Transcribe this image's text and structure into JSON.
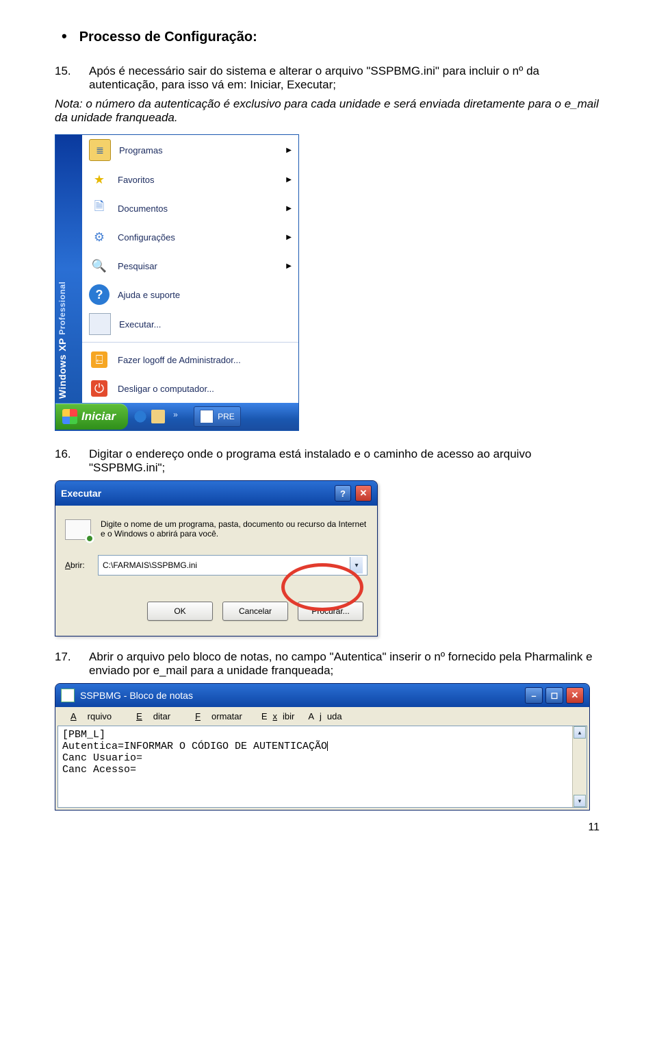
{
  "heading": "Processo de Configuração:",
  "step15": {
    "num": "15.",
    "text": "Após é necessário sair do sistema e alterar o arquivo \"SSPBMG.ini\" para incluir o nº da autenticação, para isso vá em: Iniciar, Executar;"
  },
  "note": "Nota: o número da autenticação é exclusivo para cada unidade e será enviada diretamente para o e_mail da unidade franqueada.",
  "start_menu": {
    "brand_xp": "Windows XP",
    "brand_pro": "Professional",
    "items": [
      {
        "icon": "prog",
        "label": "Programas",
        "arrow": true
      },
      {
        "icon": "fav",
        "label": "Favoritos",
        "arrow": true
      },
      {
        "icon": "doc",
        "label": "Documentos",
        "arrow": true
      },
      {
        "icon": "conf",
        "label": "Configurações",
        "arrow": true
      },
      {
        "icon": "search",
        "label": "Pesquisar",
        "arrow": true
      },
      {
        "icon": "help",
        "label": "Ajuda e suporte",
        "arrow": false
      },
      {
        "icon": "run",
        "label": "Executar...",
        "arrow": false
      }
    ],
    "logoff": "Fazer logoff de Administrador...",
    "shutdown": "Desligar o computador...",
    "start_button": "Iniciar",
    "task_label": "PRE"
  },
  "step16": {
    "num": "16.",
    "text": "Digitar o endereço onde o programa está instalado e o caminho de acesso ao arquivo \"SSPBMG.ini\";"
  },
  "exec": {
    "title": "Executar",
    "desc": "Digite o nome de um programa, pasta, documento ou recurso da Internet e o Windows o abrirá para você.",
    "open_underline": "A",
    "open_rest": "brir:",
    "value": "C:\\FARMAIS\\SSPBMG.ini",
    "ok": "OK",
    "cancel": "Cancelar",
    "browse_underline": "P",
    "browse_rest": "rocurar..."
  },
  "step17": {
    "num": "17.",
    "text": "Abrir o arquivo pelo bloco de notas, no campo \"Autentica\" inserir o nº fornecido pela Pharmalink e enviado por e_mail para a unidade franqueada;"
  },
  "notepad": {
    "title": "SSPBMG - Bloco de notas",
    "menu": [
      {
        "u": "A",
        "rest": "rquivo"
      },
      {
        "u": "E",
        "rest": "ditar"
      },
      {
        "u": "F",
        "rest": "ormatar"
      },
      {
        "u": "",
        "rest": "Exibir"
      },
      {
        "u": "",
        "rest": "Ajuda"
      }
    ],
    "menu_exibir_u": "x",
    "menu_ajuda_u": "j",
    "lines": [
      "[PBM_L]",
      "Autentica=INFORMAR O CÓDIGO DE AUTENTICAÇÃO",
      "Canc Usuario=",
      "Canc Acesso="
    ]
  },
  "page_number": "11"
}
